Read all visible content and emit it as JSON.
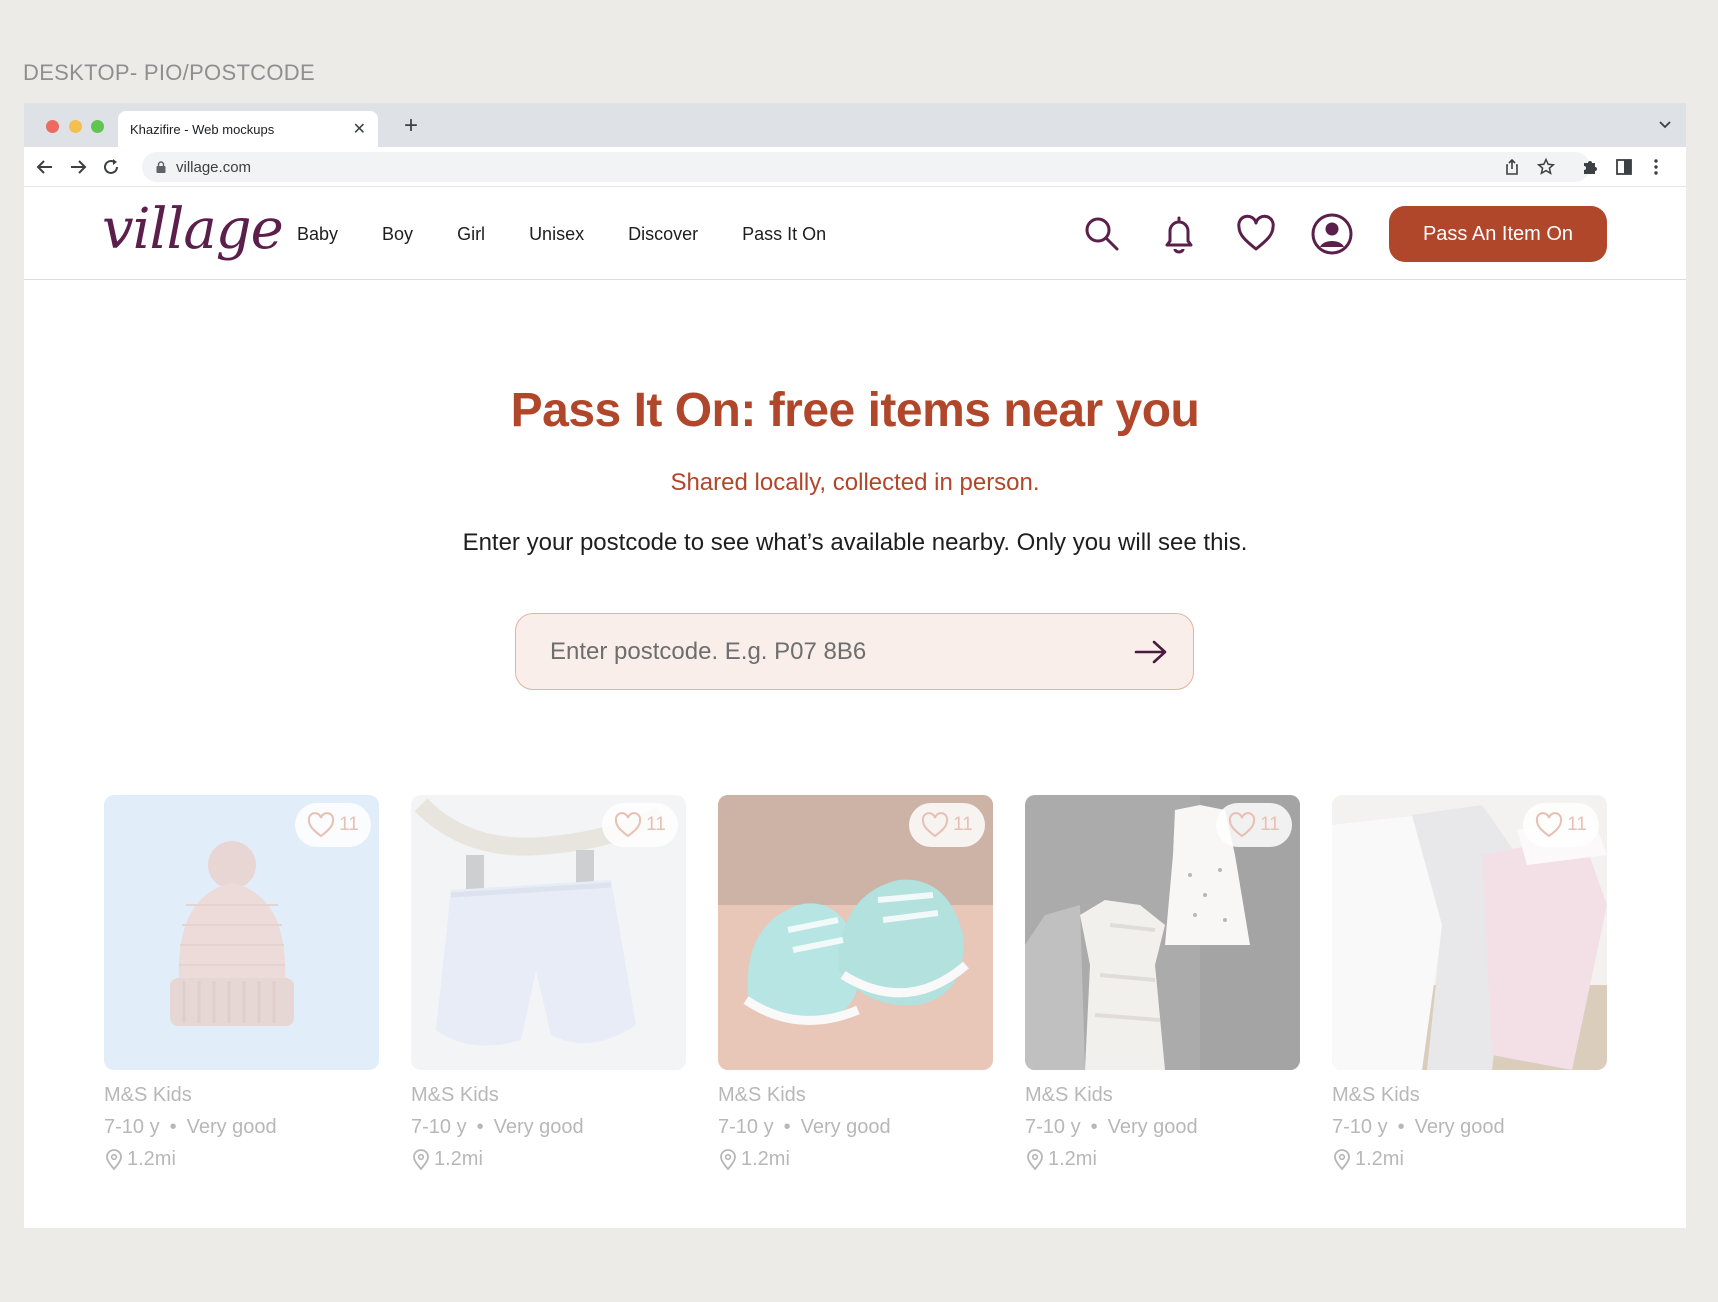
{
  "frame_label": "DESKTOP- PIO/POSTCODE",
  "browser": {
    "tab_title": "Khazifire - Web mockups",
    "tab_close": "✕",
    "new_tab": "+",
    "url": "village.com"
  },
  "header": {
    "logo": "village",
    "nav": [
      "Baby",
      "Boy",
      "Girl",
      "Unisex",
      "Discover",
      "Pass It On"
    ],
    "cta_label": "Pass An Item On"
  },
  "hero": {
    "title": "Pass It On: free items near you",
    "subtitle": "Shared locally, collected in person.",
    "description": "Enter your postcode to see what’s available nearby. Only you will see this.",
    "postcode_placeholder": "Enter postcode. E.g. P07 8B6"
  },
  "products": [
    {
      "brand": "M&S Kids",
      "age": "7-10 y",
      "condition": "Very good",
      "distance": "1.2mi",
      "likes": "11",
      "image": "knit-beanie"
    },
    {
      "brand": "M&S Kids",
      "age": "7-10 y",
      "condition": "Very good",
      "distance": "1.2mi",
      "likes": "11",
      "image": "shorts-on-hanger"
    },
    {
      "brand": "M&S Kids",
      "age": "7-10 y",
      "condition": "Very good",
      "distance": "1.2mi",
      "likes": "11",
      "image": "baby-shoes"
    },
    {
      "brand": "M&S Kids",
      "age": "7-10 y",
      "condition": "Very good",
      "distance": "1.2mi",
      "likes": "11",
      "image": "hanging-dresses"
    },
    {
      "brand": "M&S Kids",
      "age": "7-10 y",
      "condition": "Very good",
      "distance": "1.2mi",
      "likes": "11",
      "image": "baby-onesies"
    }
  ],
  "colors": {
    "brand_primary": "#b0462a",
    "logo_plum": "#5a1f4b",
    "input_bg": "#f9eeea",
    "page_bg": "#edebe7"
  }
}
